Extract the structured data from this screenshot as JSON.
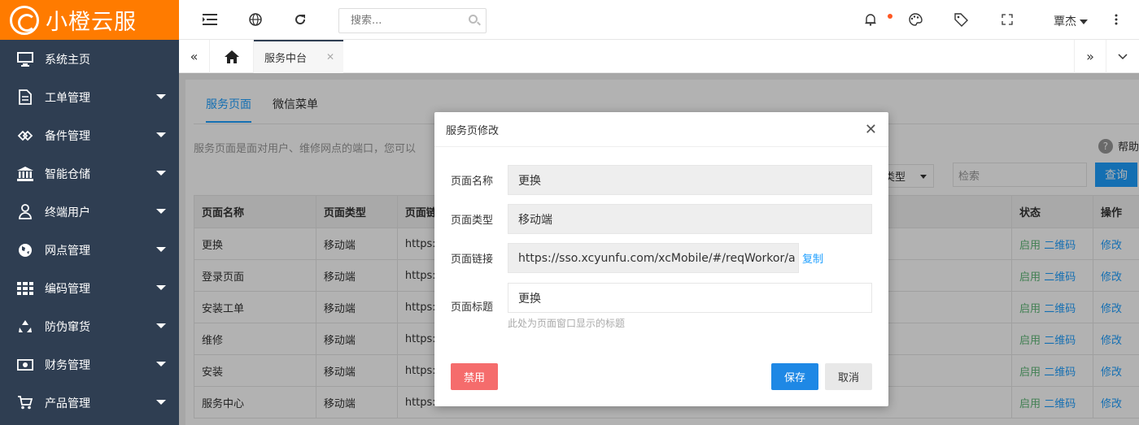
{
  "app": {
    "logo_text": "小橙云服"
  },
  "sidebar": {
    "items": [
      {
        "label": "系统主页",
        "icon": "monitor-icon"
      },
      {
        "label": "工单管理",
        "icon": "document-icon"
      },
      {
        "label": "备件管理",
        "icon": "diamond-icon"
      },
      {
        "label": "智能仓储",
        "icon": "bank-icon"
      },
      {
        "label": "终端用户",
        "icon": "user-icon"
      },
      {
        "label": "网点管理",
        "icon": "globe-icon"
      },
      {
        "label": "编码管理",
        "icon": "grid-icon"
      },
      {
        "label": "防伪窜货",
        "icon": "recycle-icon"
      },
      {
        "label": "财务管理",
        "icon": "money-icon"
      },
      {
        "label": "产品管理",
        "icon": "cart-icon"
      }
    ]
  },
  "topbar": {
    "search_placeholder": "搜索...",
    "user_name": "覃杰"
  },
  "tabs": {
    "active_label": "服务中台"
  },
  "content": {
    "tabs": [
      "服务页面",
      "微信菜单"
    ],
    "description": "服务页面是面对用户、维修网点的端口，您可以",
    "help_label": "帮助",
    "type_select": "类型",
    "query_placeholder": "检索",
    "query_button": "查询",
    "table": {
      "headers": [
        "页面名称",
        "页面类型",
        "页面链",
        "状态",
        "操作"
      ],
      "rows": [
        {
          "name": "更换",
          "type": "移动端",
          "link": "https:",
          "status": "启用",
          "qr": "二维码",
          "op": "修改"
        },
        {
          "name": "登录页面",
          "type": "移动端",
          "link": "https:",
          "status": "启用",
          "qr": "二维码",
          "op": "修改"
        },
        {
          "name": "安装工单",
          "type": "移动端",
          "link": "https:",
          "status": "启用",
          "qr": "二维码",
          "op": "修改"
        },
        {
          "name": "维修",
          "type": "移动端",
          "link": "https:",
          "status": "启用",
          "qr": "二维码",
          "op": "修改"
        },
        {
          "name": "安装",
          "type": "移动端",
          "link": "https:",
          "status": "启用",
          "qr": "二维码",
          "op": "修改"
        },
        {
          "name": "服务中心",
          "type": "移动端",
          "link": "https:",
          "status": "启用",
          "qr": "二维码",
          "op": "修改"
        }
      ]
    }
  },
  "modal": {
    "title": "服务页修改",
    "fields": {
      "name_label": "页面名称",
      "name_value": "更换",
      "type_label": "页面类型",
      "type_value": "移动端",
      "link_label": "页面链接",
      "link_value": "https://sso.xcyunfu.com/xcMobile/#/reqWorkor/a",
      "copy_label": "复制",
      "title_label": "页面标题",
      "title_value": "更换",
      "title_hint": "此处为页面窗口显示的标题"
    },
    "disable_button": "禁用",
    "save_button": "保存",
    "cancel_button": "取消"
  }
}
